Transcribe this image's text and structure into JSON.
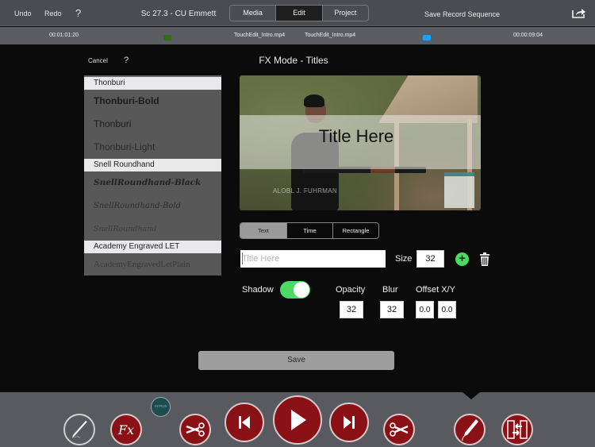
{
  "topbar": {
    "undo": "Undo",
    "redo": "Redo",
    "help": "?",
    "scene": "Sc 27.3 - CU Emmett",
    "segments": [
      {
        "label": "Media",
        "active": false
      },
      {
        "label": "Edit",
        "active": true
      },
      {
        "label": "Project",
        "active": false
      }
    ],
    "save_sequence": "Save Record Sequence",
    "share_icon": "share-icon"
  },
  "timeline": {
    "left_timecode": "00:01:01:20",
    "left_clip": "TouchEdit_Intro.mp4",
    "right_clip": "TouchEdit_Intro.mp4",
    "right_timecode": "00:00:09:04",
    "left_marker_color": "#2f6b1a",
    "right_marker_color": "#1fa0ff"
  },
  "fx_panel": {
    "cancel": "Cancel",
    "help": "?",
    "title": "FX Mode - Titles",
    "font_groups": [
      {
        "header": "Thonburi",
        "items": [
          "Thonburi-Bold",
          "Thonburi",
          "Thonburi-Light"
        ]
      },
      {
        "header": "Snell Roundhand",
        "items": [
          "SnellRoundhand-Black",
          "SnellRoundhand-Bold",
          "SnellRoundhand"
        ]
      },
      {
        "header": "Academy Engraved LET",
        "items": [
          "AcademyEngravedLetPlain"
        ]
      }
    ],
    "preview": {
      "title_text": "Title Here",
      "credit_text": "ALOBL J. FUHRMAN"
    },
    "tabs": [
      {
        "label": "Text",
        "active": true
      },
      {
        "label": "Time",
        "active": false
      },
      {
        "label": "Rectangle",
        "active": false
      }
    ],
    "title_input": {
      "value": "",
      "placeholder": "Title Here"
    },
    "size_label": "Size",
    "size_value": "32",
    "shadow_label": "Shadow",
    "shadow_on": true,
    "opacity_label": "Opacity",
    "opacity_value": "32",
    "blur_label": "Blur",
    "blur_value": "32",
    "offset_label": "Offset X/Y",
    "offset_x": "0.0",
    "offset_y": "0.0",
    "save": "Save"
  },
  "toolbar": {
    "scrub_label": "SCRUB",
    "buttons": [
      "pen-tool",
      "fx",
      "split-cut",
      "previous",
      "play",
      "next",
      "scissors",
      "titles-pen",
      "swap-clips"
    ],
    "accent": "#8a1116"
  }
}
